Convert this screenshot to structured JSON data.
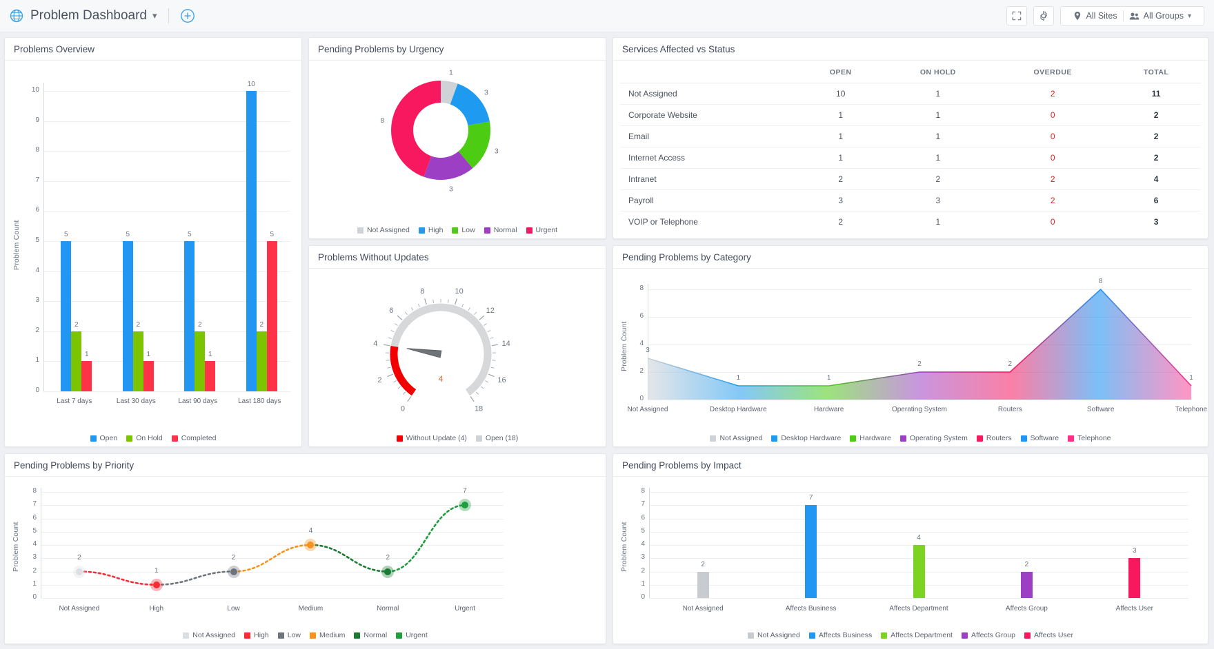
{
  "header": {
    "title": "Problem Dashboard",
    "globe_icon": "globe-icon",
    "caret_icon": "chevron-down-icon",
    "add_icon": "plus-circle-icon",
    "fullscreen_icon": "fullscreen-icon",
    "settings_icon": "gear-icon",
    "site_filter": "All Sites",
    "group_filter": "All Groups",
    "site_icon": "location-pin-icon",
    "group_icon": "users-icon"
  },
  "cards": {
    "problems_overview": "Problems Overview",
    "pending_by_urgency": "Pending Problems by Urgency",
    "services_affected": "Services Affected vs Status",
    "problems_without_updates": "Problems Without Updates",
    "pending_by_category": "Pending Problems by Category",
    "pending_by_priority": "Pending Problems by Priority",
    "pending_by_impact": "Pending Problems by Impact"
  },
  "services_table": {
    "columns": [
      "",
      "OPEN",
      "ON HOLD",
      "OVERDUE",
      "TOTAL"
    ],
    "rows": [
      {
        "service": "Not Assigned",
        "open": "10",
        "on_hold": "1",
        "overdue": "2",
        "total": "11"
      },
      {
        "service": "Corporate Website",
        "open": "1",
        "on_hold": "1",
        "overdue": "0",
        "total": "2"
      },
      {
        "service": "Email",
        "open": "1",
        "on_hold": "1",
        "overdue": "0",
        "total": "2"
      },
      {
        "service": "Internet Access",
        "open": "1",
        "on_hold": "1",
        "overdue": "0",
        "total": "2"
      },
      {
        "service": "Intranet",
        "open": "2",
        "on_hold": "2",
        "overdue": "2",
        "total": "4"
      },
      {
        "service": "Payroll",
        "open": "3",
        "on_hold": "3",
        "overdue": "2",
        "total": "6"
      },
      {
        "service": "VOIP or Telephone",
        "open": "2",
        "on_hold": "1",
        "overdue": "0",
        "total": "3"
      }
    ]
  },
  "chart_data": [
    {
      "id": "problems_overview",
      "type": "bar",
      "title": "Problems Overview",
      "xlabel": "",
      "ylabel": "Problem Count",
      "ylim": [
        0,
        10
      ],
      "yticks": [
        "0",
        "1",
        "2",
        "3",
        "4",
        "5",
        "6",
        "7",
        "8",
        "9",
        "10"
      ],
      "grid": true,
      "legend_position": "bottom",
      "categories": [
        "Last 7 days",
        "Last 30 days",
        "Last 90 days",
        "Last 180 days"
      ],
      "series": [
        {
          "name": "Open",
          "color": "#2196f3",
          "values": [
            5,
            5,
            5,
            10
          ]
        },
        {
          "name": "On Hold",
          "color": "#7cc400",
          "values": [
            2,
            2,
            2,
            2
          ]
        },
        {
          "name": "Completed",
          "color": "#ff3347",
          "values": [
            1,
            1,
            1,
            5
          ]
        }
      ]
    },
    {
      "id": "pending_by_urgency",
      "type": "pie",
      "title": "Pending Problems by Urgency",
      "legend_position": "bottom",
      "labels": [
        "Not Assigned",
        "High",
        "Low",
        "Normal",
        "Urgent"
      ],
      "values": [
        1,
        3,
        3,
        3,
        8
      ],
      "colors": [
        "#cfd2d6",
        "#1e9bf0",
        "#4ccc12",
        "#9c3fc4",
        "#f7185f"
      ]
    },
    {
      "id": "problems_without_updates",
      "type": "gauge",
      "title": "Problems Without Updates",
      "value": 4,
      "min": 0,
      "max": 18,
      "ticks": [
        "0",
        "2",
        "4",
        "6",
        "8",
        "10",
        "12",
        "14",
        "16",
        "18"
      ],
      "value_label": "4",
      "legend_position": "bottom",
      "legend": [
        {
          "name": "Without Update (4)",
          "color": "#f20000"
        },
        {
          "name": "Open (18)",
          "color": "#cfd2d6"
        }
      ]
    },
    {
      "id": "pending_by_category",
      "type": "area",
      "title": "Pending Problems by Category",
      "ylabel": "Problem Count",
      "ylim": [
        0,
        8
      ],
      "yticks": [
        "0",
        "2",
        "4",
        "6",
        "8"
      ],
      "grid": true,
      "legend_position": "bottom",
      "categories": [
        "Not Assigned",
        "Desktop Hardware",
        "Hardware",
        "Operating System",
        "Routers",
        "Software",
        "Telephone"
      ],
      "values": [
        3,
        1,
        1,
        2,
        2,
        8,
        1
      ],
      "colors": [
        "#cfd2d6",
        "#1e9bf0",
        "#4ccc12",
        "#9c3fc4",
        "#f7185f",
        "#2196f3",
        "#ff2d8a"
      ],
      "legend_labels": [
        "Not Assigned",
        "Desktop Hardware",
        "Hardware",
        "Operating System",
        "Routers",
        "Software",
        "Telephone"
      ]
    },
    {
      "id": "pending_by_priority",
      "type": "line",
      "title": "Pending Problems by Priority",
      "ylabel": "Problem Count",
      "ylim": [
        0,
        8
      ],
      "yticks": [
        "0",
        "1",
        "2",
        "3",
        "4",
        "5",
        "6",
        "7",
        "8"
      ],
      "grid": true,
      "legend_position": "bottom",
      "categories": [
        "Not Assigned",
        "High",
        "Low",
        "Medium",
        "Normal",
        "Urgent"
      ],
      "values": [
        2,
        1,
        2,
        4,
        2,
        7
      ],
      "colors": [
        "#dcdfe2",
        "#f72c36",
        "#6d747c",
        "#f6921e",
        "#1b7a33",
        "#1f9e3e"
      ],
      "legend_labels": [
        "Not Assigned",
        "High",
        "Low",
        "Medium",
        "Normal",
        "Urgent"
      ]
    },
    {
      "id": "pending_by_impact",
      "type": "bar",
      "title": "Pending Problems by Impact",
      "ylabel": "Problem Count",
      "ylim": [
        0,
        8
      ],
      "yticks": [
        "0",
        "1",
        "2",
        "3",
        "4",
        "5",
        "6",
        "7",
        "8"
      ],
      "grid": true,
      "legend_position": "bottom",
      "categories": [
        "Not Assigned",
        "Affects Business",
        "Affects Department",
        "Affects Group",
        "Affects User"
      ],
      "values": [
        2,
        7,
        4,
        2,
        3
      ],
      "colors": [
        "#c8cbcf",
        "#2196f3",
        "#7cd321",
        "#9c3fc4",
        "#f7185f"
      ],
      "legend_labels": [
        "Not Assigned",
        "Affects Business",
        "Affects Department",
        "Affects Group",
        "Affects User"
      ]
    }
  ]
}
